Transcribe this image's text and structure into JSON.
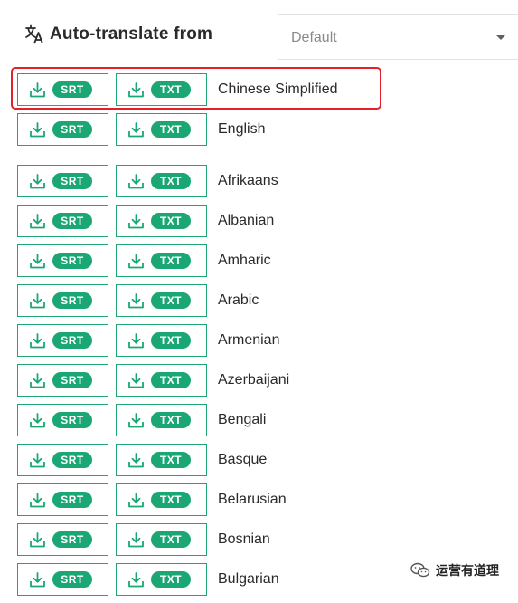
{
  "header": {
    "title": "Auto-translate from",
    "select": {
      "value": "Default"
    }
  },
  "buttons": {
    "srt": "SRT",
    "txt": "TXT"
  },
  "languages": [
    "Chinese Simplified",
    "English",
    "Afrikaans",
    "Albanian",
    "Amharic",
    "Arabic",
    "Armenian",
    "Azerbaijani",
    "Bengali",
    "Basque",
    "Belarusian",
    "Bosnian",
    "Bulgarian"
  ],
  "watermark": {
    "text": "运营有道理"
  },
  "colors": {
    "accent": "#1aa774",
    "highlight": "#e5202a"
  },
  "icons": {
    "header": "translate-icon",
    "button": "download-icon",
    "watermark": "wechat-logo-icon"
  }
}
